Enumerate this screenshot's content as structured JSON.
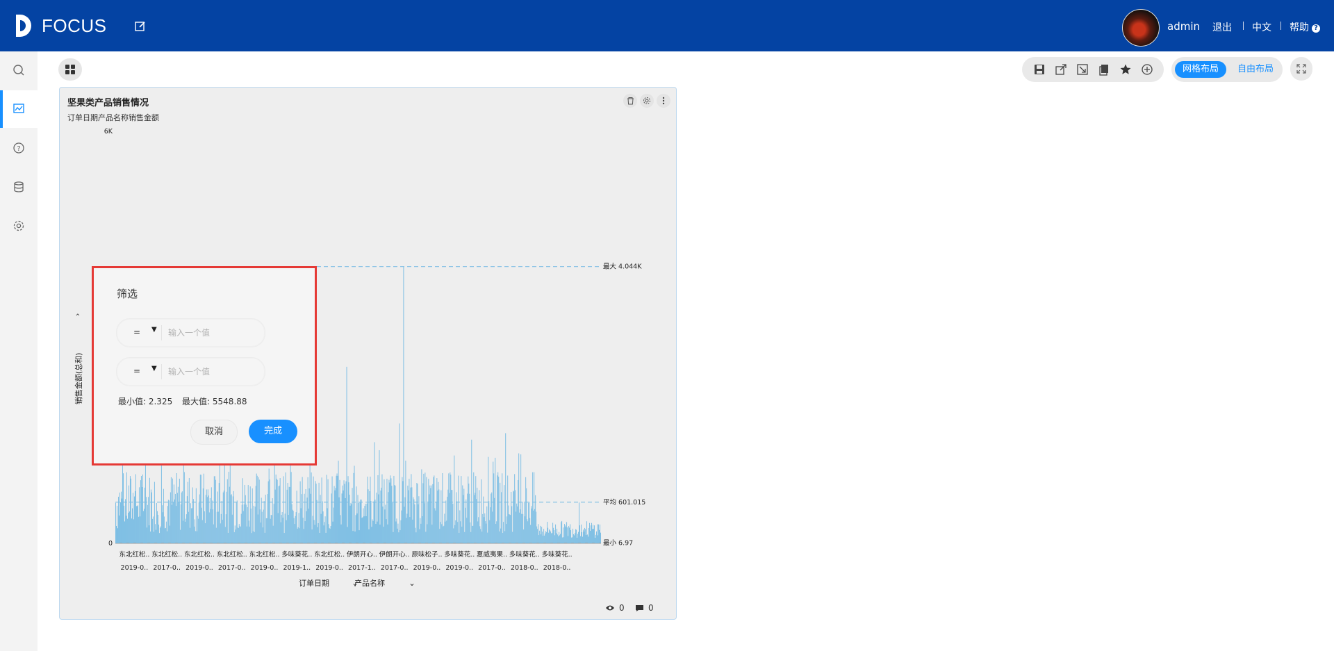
{
  "header": {
    "logo_text": "FOCUS",
    "username": "admin",
    "logout": "退出",
    "language": "中文",
    "help": "帮助",
    "help_icon_glyph": "?"
  },
  "sidebar": {
    "items": [
      {
        "icon": "search-icon",
        "active": false
      },
      {
        "icon": "dashboard-icon",
        "active": true
      },
      {
        "icon": "help-circle-icon",
        "active": false
      },
      {
        "icon": "database-icon",
        "active": false
      },
      {
        "icon": "settings-icon",
        "active": false
      }
    ]
  },
  "toolbar": {
    "icons": [
      "save-icon",
      "share-icon",
      "export-icon",
      "copy-icon",
      "star-icon",
      "add-icon"
    ],
    "layout_grid": "网格布局",
    "layout_free": "自由布局"
  },
  "card": {
    "title": "坚果类产品销售情况",
    "subtitle": "订单日期产品名称销售金额",
    "views": "0",
    "comments": "0"
  },
  "chart_data": {
    "type": "bar",
    "ylabel": "销售金额(总和)",
    "yticks": [
      "0",
      "6K"
    ],
    "ylim": [
      0,
      6000
    ],
    "x_dimensions": [
      "订单日期",
      "产品名称"
    ],
    "category_labels_top": [
      "东北红松..",
      "东北红松..",
      "东北红松..",
      "东北红松..",
      "东北红松..",
      "多味葵花..",
      "东北红松..",
      "伊朗开心..",
      "伊朗开心..",
      "原味松子..",
      "多味葵花..",
      "夏威夷果..",
      "多味葵花..",
      "多味葵花.."
    ],
    "category_labels_bottom": [
      "2019-0..",
      "2017-0..",
      "2019-0..",
      "2017-0..",
      "2019-0..",
      "2019-1..",
      "2019-0..",
      "2017-1..",
      "2017-0..",
      "2019-0..",
      "2019-0..",
      "2017-0..",
      "2018-0..",
      "2018-0.."
    ],
    "reference_lines": {
      "max": {
        "label": "最大 4.044K",
        "value": 4044
      },
      "avg": {
        "label": "平均 601.015",
        "value": 601.015
      },
      "min": {
        "label": "最小 6.97",
        "value": 6.97
      }
    },
    "bar_color": "#7fbfe4",
    "series": [
      {
        "values": []
      }
    ]
  },
  "filter": {
    "title": "筛选",
    "row1_operator": "=",
    "row1_placeholder": "输入一个值",
    "row2_operator": "=",
    "row2_placeholder": "输入一个值",
    "min_value": "最小值: 2.325",
    "max_value": "最大值: 5548.88",
    "cancel": "取消",
    "done": "完成"
  }
}
